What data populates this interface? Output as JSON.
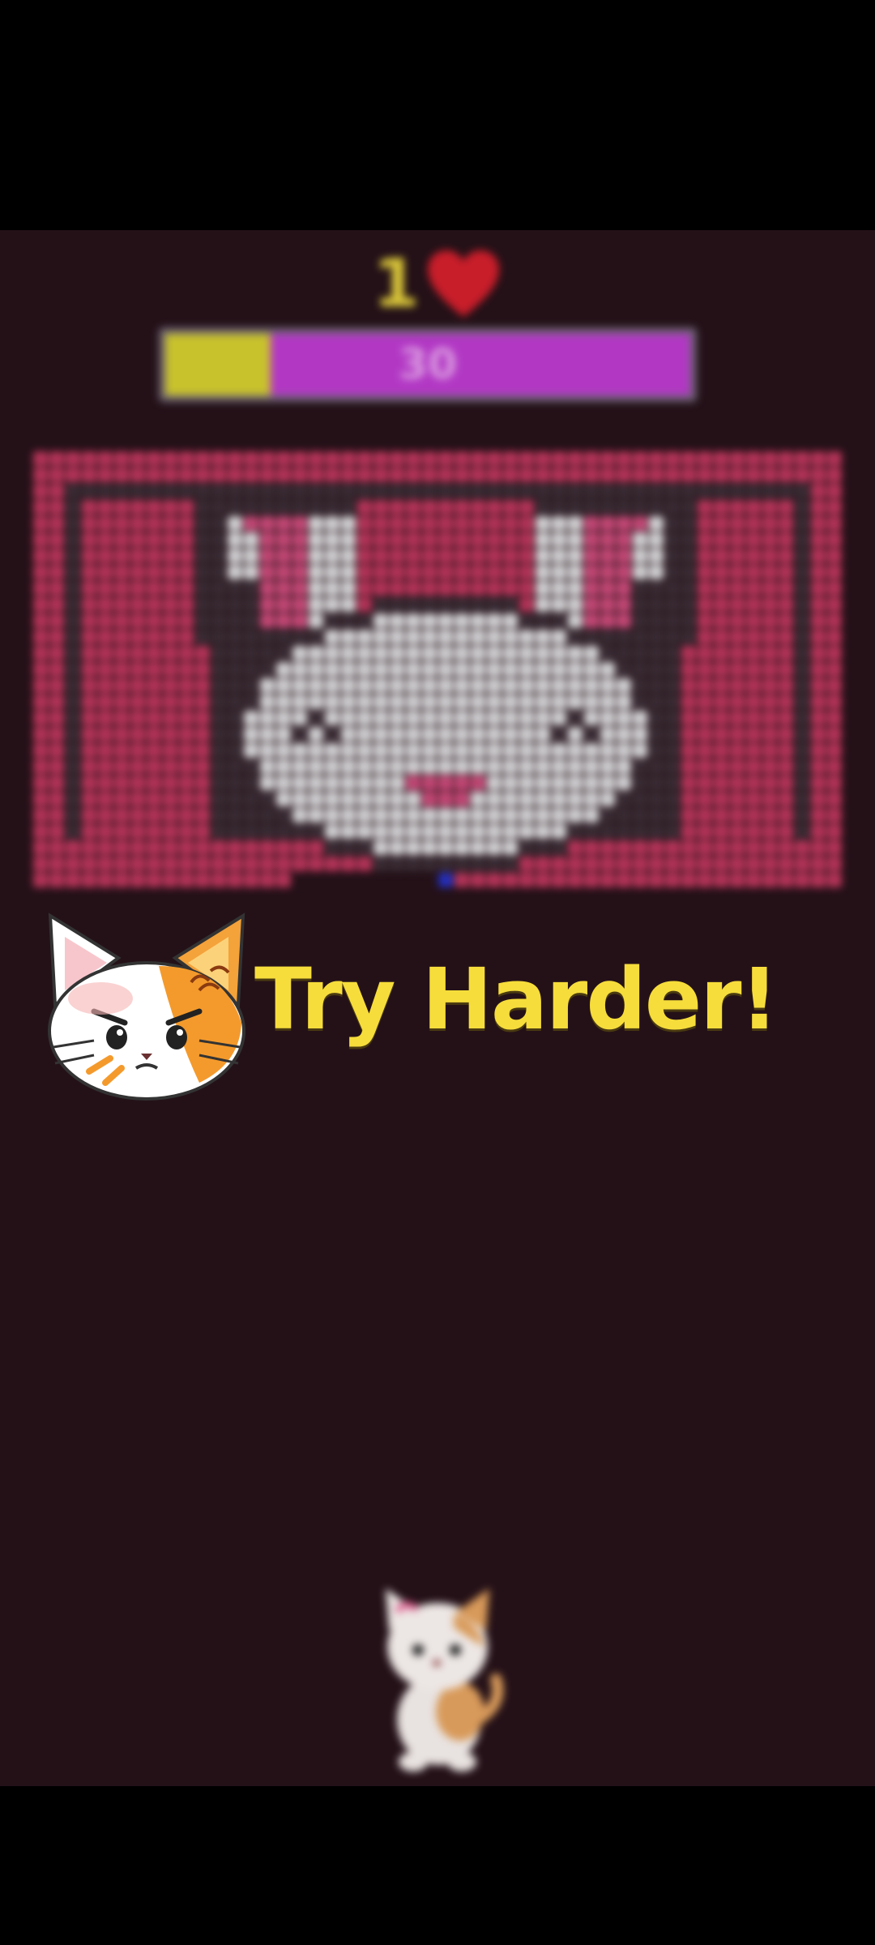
{
  "hud": {
    "lives": "1",
    "lives_icon": "heart-icon",
    "progress_value": "30",
    "progress_fraction": 0.2,
    "progress_fill_color": "#c8c22c",
    "progress_track_color": "#b238c4"
  },
  "banner": {
    "text": "Try Harder!",
    "icon": "angry-cat-icon",
    "text_color": "#f6dd3b"
  },
  "board": {
    "picture": "pixel bunny face",
    "colors": {
      "border": "#b8355a",
      "dark": "#3a2c34",
      "white": "#d6d6d8",
      "pink": "#c84a78",
      "blue": "#2530c0"
    }
  },
  "player": {
    "icon": "cat-player-icon"
  },
  "colors": {
    "background": "#241118",
    "letterbox": "#000000"
  }
}
